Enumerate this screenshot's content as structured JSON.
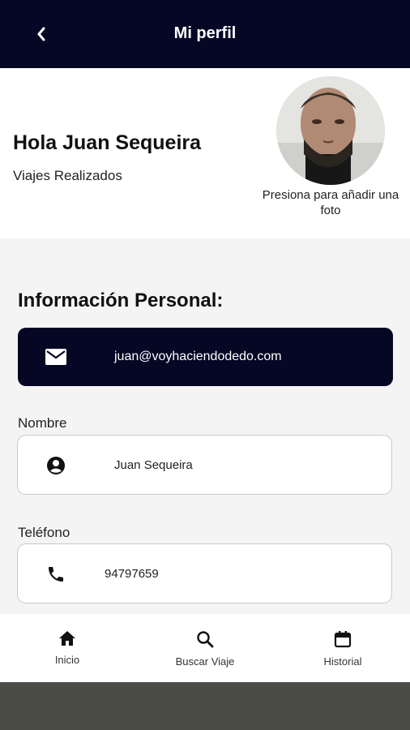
{
  "header": {
    "title": "Mi perfil",
    "back_icon": "chevron-left-icon"
  },
  "profile": {
    "greeting": "Hola Juan Sequeira",
    "trips_label": "Viajes Realizados",
    "photo_hint": "Presiona para añadir una foto"
  },
  "personal": {
    "title": "Información Personal:",
    "email": "juan@voyhaciendodedo.com",
    "name_label": "Nombre",
    "name_value": "Juan Sequeira",
    "phone_label": "Teléfono",
    "phone_value": "94797659"
  },
  "nav": {
    "items": [
      {
        "label": "Inicio",
        "icon": "home-icon"
      },
      {
        "label": "Buscar Viaje",
        "icon": "search-icon"
      },
      {
        "label": "Historial",
        "icon": "calendar-icon"
      }
    ]
  },
  "colors": {
    "primary": "#060625",
    "background": "#f4f4f4",
    "footer": "#4c4c46"
  }
}
